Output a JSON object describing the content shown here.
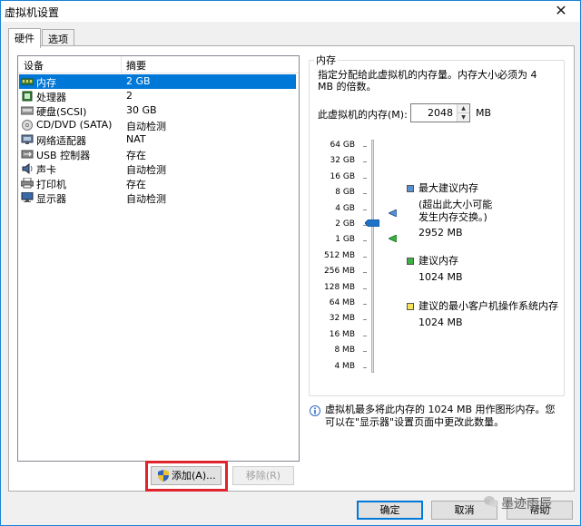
{
  "window": {
    "title": "虚拟机设置",
    "close_glyph": "✕"
  },
  "tabs": [
    {
      "label": "硬件",
      "active": true
    },
    {
      "label": "选项",
      "active": false
    }
  ],
  "device_list": {
    "col_device": "设备",
    "col_summary": "摘要",
    "rows": [
      {
        "name": "内存",
        "summary": "2 GB",
        "icon": "memory-icon",
        "selected": true
      },
      {
        "name": "处理器",
        "summary": "2",
        "icon": "processor-icon"
      },
      {
        "name": "硬盘(SCSI)",
        "summary": "30 GB",
        "icon": "hard-disk-icon"
      },
      {
        "name": "CD/DVD (SATA)",
        "summary": "自动检测",
        "icon": "cd-dvd-icon"
      },
      {
        "name": "网络适配器",
        "summary": "NAT",
        "icon": "network-adapter-icon"
      },
      {
        "name": "USB 控制器",
        "summary": "存在",
        "icon": "usb-icon"
      },
      {
        "name": "声卡",
        "summary": "自动检测",
        "icon": "sound-card-icon"
      },
      {
        "name": "打印机",
        "summary": "存在",
        "icon": "printer-icon"
      },
      {
        "name": "显示器",
        "summary": "自动检测",
        "icon": "display-icon"
      }
    ]
  },
  "buttons": {
    "add": "添加(A)...",
    "remove": "移除(R)",
    "ok": "确定",
    "cancel": "取消",
    "help": "帮助"
  },
  "memory": {
    "group_title": "内存",
    "description": "指定分配给此虚拟机的内存量。内存大小必须为 4 MB 的倍数。",
    "field_label": "此虚拟机的内存(M):",
    "value": "2048",
    "unit": "MB",
    "scale": [
      "64 GB",
      "32 GB",
      "16 GB",
      "8 GB",
      "4 GB",
      "2 GB",
      "1 GB",
      "512 MB",
      "256 MB",
      "128 MB",
      "64 MB",
      "32 MB",
      "16 MB",
      "8 MB",
      "4 MB"
    ],
    "max_recommended_label": "最大建议内存",
    "max_recommended_note": "(超出此大小可能发生内存交换。)",
    "max_recommended_value": "2952 MB",
    "recommended_label": "建议内存",
    "recommended_value": "1024 MB",
    "min_guest_label": "建议的最小客户机操作系统内存",
    "min_guest_value": "1024 MB",
    "colors": {
      "max": "#5b8fd0",
      "recommended": "#3cb043",
      "min": "#f2e35a",
      "thumb": "#1e73c8"
    }
  },
  "info": {
    "text": "虚拟机最多将此内存的 1024 MB 用作图形内存。您可以在\"显示器\"设置页面中更改此数量。"
  },
  "watermark": {
    "text": "墨迹雨辰"
  }
}
